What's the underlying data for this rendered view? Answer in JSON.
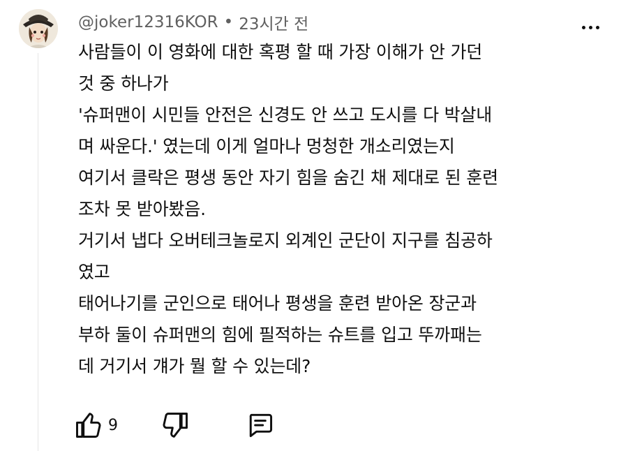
{
  "comment": {
    "author": "@joker12316KOR",
    "separator": "•",
    "time": "23시간 전",
    "lines": [
      "사람들이 이 영화에 대한 혹평 할 때 가장 이해가 안 가던",
      "것 중 하나가",
      "'슈퍼맨이 시민들 안전은 신경도 안 쓰고 도시를 다 박살내",
      "며 싸운다.' 였는데 이게 얼마나 멍청한 개소리였는지",
      "여기서 클락은 평생 동안 자기 힘을 숨긴 채 제대로 된 훈련",
      "조차 못 받아봤음.",
      "거기서 냅다 오버테크놀로지 외계인 군단이 지구를 침공하",
      "였고",
      "태어나기를 군인으로 태어나 평생을 훈련 받아온 장군과",
      "부하 둘이 슈퍼맨의 힘에 필적하는 슈트를 입고 뚜까패는",
      "데 거기서 걔가 뭘 할 수 있는데?"
    ],
    "like_count": "9"
  },
  "icons": {
    "avatar": "avatar",
    "more": "more-vert-icon",
    "like": "thumbs-up-icon",
    "dislike": "thumbs-down-icon",
    "reply": "reply-comment-icon"
  }
}
